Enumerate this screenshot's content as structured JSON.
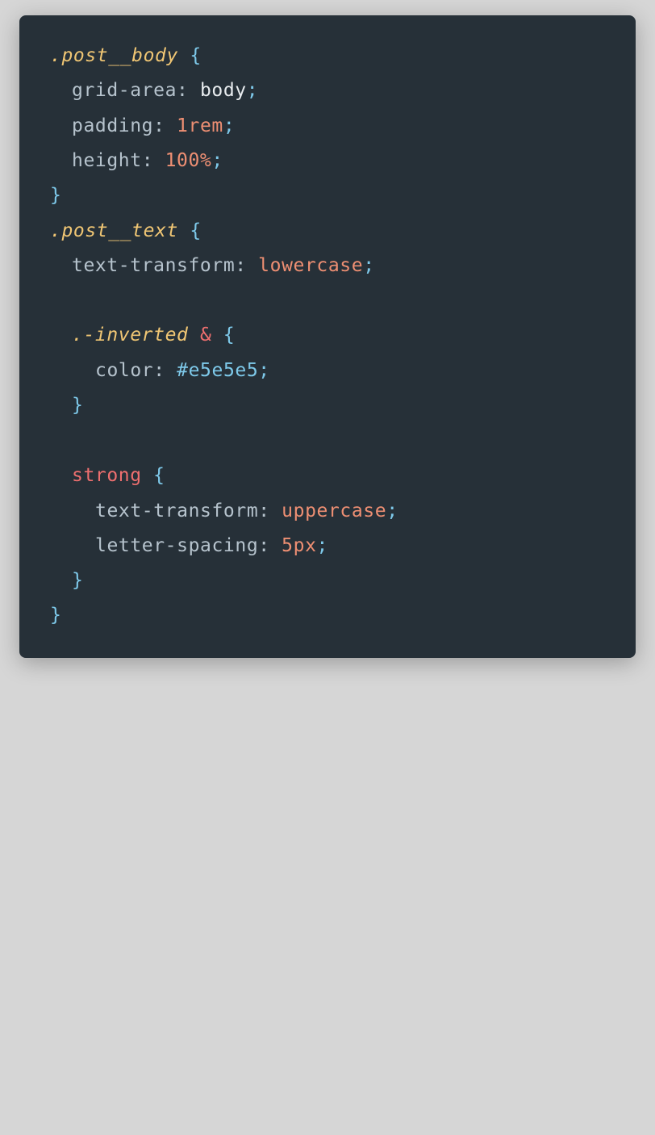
{
  "code": {
    "lines": [
      {
        "sel": ".post__body",
        "open": "{"
      },
      {
        "prop": "grid-area",
        "value": "body"
      },
      {
        "prop": "padding",
        "value": "1rem"
      },
      {
        "prop": "height",
        "value": "100%"
      },
      {
        "close": "}"
      },
      {
        "sel": ".post__text",
        "open": "{"
      },
      {
        "prop": "text-transform",
        "value": "lowercase"
      },
      {
        "blank": ""
      },
      {
        "sel": ".-inverted",
        "amp": "&",
        "open": "{"
      },
      {
        "prop": "color",
        "value": "#e5e5e5"
      },
      {
        "close": "}"
      },
      {
        "blank": ""
      },
      {
        "tag": "strong",
        "open": "{"
      },
      {
        "prop": "text-transform",
        "value": "uppercase"
      },
      {
        "prop": "letter-spacing",
        "value": "5px"
      },
      {
        "close": "}"
      },
      {
        "close": "}"
      }
    ],
    "colon": ":",
    "semicolon": ";"
  },
  "colors": {
    "page_background": "#d6d6d6",
    "editor_background": "#263038",
    "selector": "#f0c674",
    "brace": "#7ec9ea",
    "property": "#b6c3cd",
    "value_number": "#ee8f73",
    "value_hex": "#7ec9ea",
    "tag": "#ee6f6f"
  }
}
